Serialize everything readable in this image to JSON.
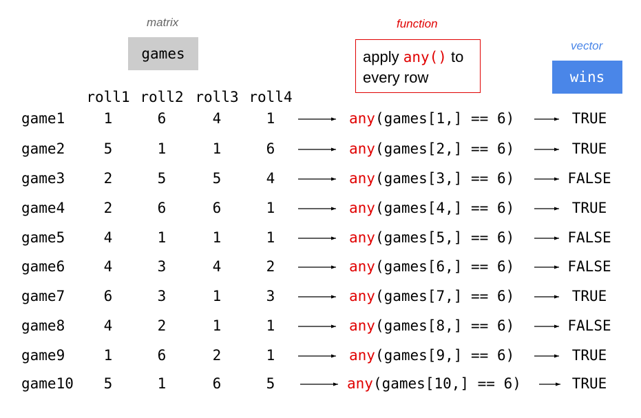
{
  "labels": {
    "matrix": "matrix",
    "function": "function",
    "vector": "vector"
  },
  "matrix_name": "games",
  "vector_name": "wins",
  "function_desc": {
    "pre": "apply ",
    "fn": "any()",
    "post": " to",
    "line2": "every row"
  },
  "columns": [
    "roll1",
    "roll2",
    "roll3",
    "roll4"
  ],
  "fn_keyword": "any",
  "rows": [
    {
      "name": "game1",
      "values": [
        1,
        6,
        4,
        1
      ],
      "expr": "(games[1,] == 6)",
      "result": "TRUE"
    },
    {
      "name": "game2",
      "values": [
        5,
        1,
        1,
        6
      ],
      "expr": "(games[2,] == 6)",
      "result": "TRUE"
    },
    {
      "name": "game3",
      "values": [
        2,
        5,
        5,
        4
      ],
      "expr": "(games[3,] == 6)",
      "result": "FALSE"
    },
    {
      "name": "game4",
      "values": [
        2,
        6,
        6,
        1
      ],
      "expr": "(games[4,] == 6)",
      "result": "TRUE"
    },
    {
      "name": "game5",
      "values": [
        4,
        1,
        1,
        1
      ],
      "expr": "(games[5,] == 6)",
      "result": "FALSE"
    },
    {
      "name": "game6",
      "values": [
        4,
        3,
        4,
        2
      ],
      "expr": "(games[6,] == 6)",
      "result": "FALSE"
    },
    {
      "name": "game7",
      "values": [
        6,
        3,
        1,
        3
      ],
      "expr": "(games[7,] == 6)",
      "result": "TRUE"
    },
    {
      "name": "game8",
      "values": [
        4,
        2,
        1,
        1
      ],
      "expr": "(games[8,] == 6)",
      "result": "FALSE"
    },
    {
      "name": "game9",
      "values": [
        1,
        6,
        2,
        1
      ],
      "expr": "(games[9,] == 6)",
      "result": "TRUE"
    },
    {
      "name": "game10",
      "values": [
        5,
        1,
        6,
        5
      ],
      "expr": "(games[10,] == 6)",
      "result": "TRUE"
    }
  ],
  "colors": {
    "function_red": "#e00000",
    "vector_blue": "#4a86e8",
    "matrix_gray": "#cccccc",
    "caption_gray": "#666666"
  }
}
